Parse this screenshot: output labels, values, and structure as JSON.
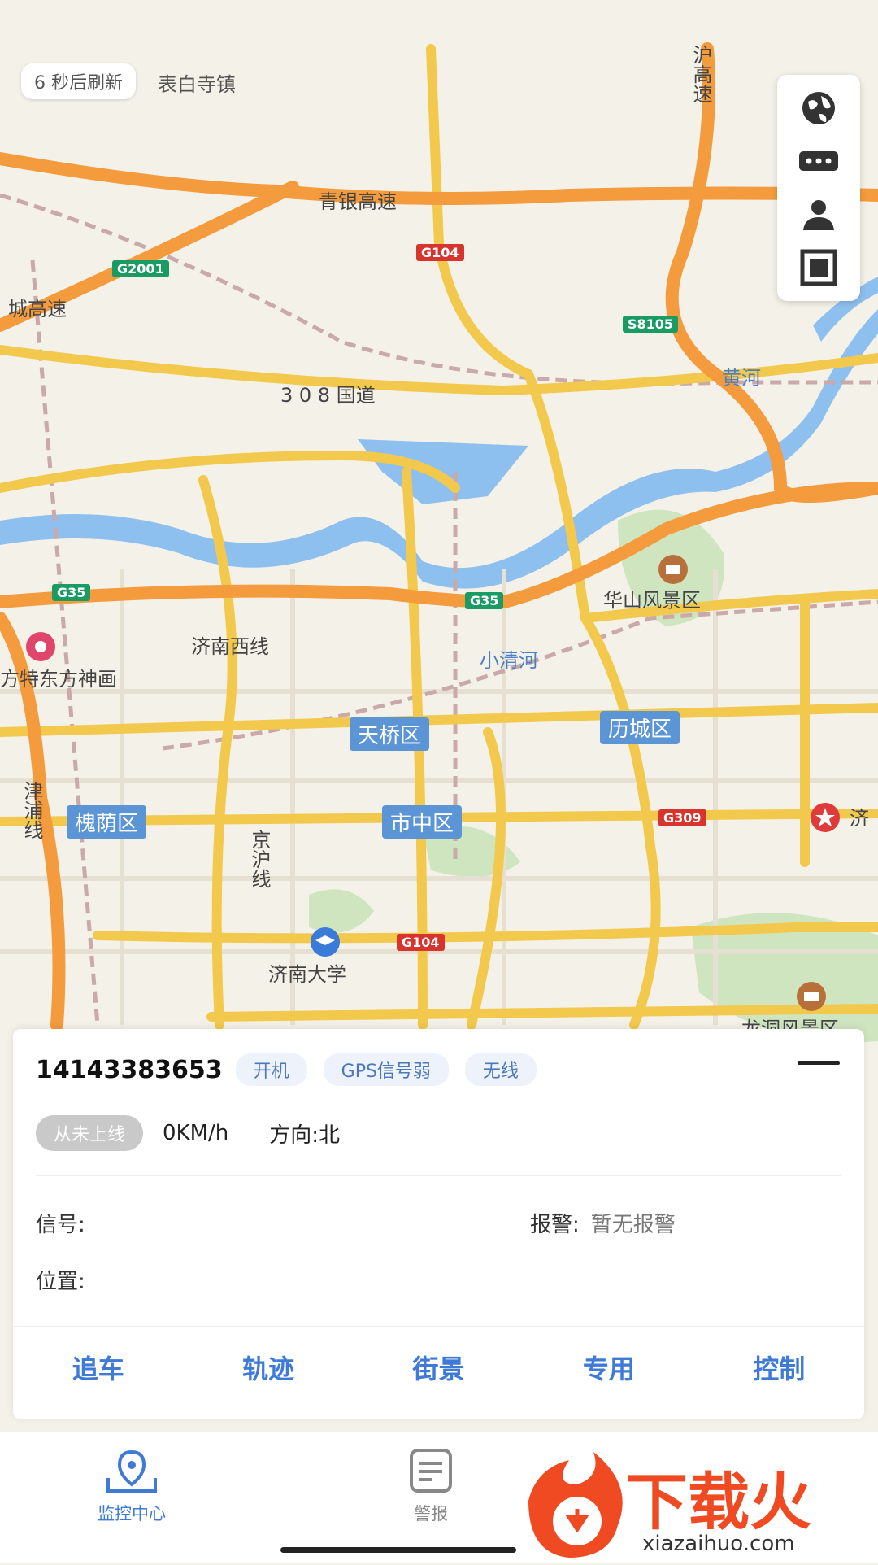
{
  "map": {
    "refresh_text": "6 秒后刷新",
    "town_label": "表白寺镇",
    "labels": {
      "highway_hu": "沪高速",
      "qingyin": "青银高速",
      "guodao_308": "3 0 8 国道",
      "yellow_river": "黄河",
      "huashan": "华山风景区",
      "jinan_west": "济南西线",
      "xiaoqinghe": "小清河",
      "fangte": "方特东方神画",
      "jinhu_line": "京沪线",
      "jinpu_line": "津浦线",
      "jinan_univ": "济南大学",
      "longdong": "龙洞风景区",
      "ji": "济",
      "lingcheng": "城高速"
    },
    "districts": {
      "tianqiao": "天桥区",
      "licheng": "历城区",
      "huaiyin": "槐荫区",
      "shizhong": "市中区"
    },
    "shields": {
      "g2001": "G2001",
      "g104a": "G104",
      "s8105": "S8105",
      "g35a": "G35",
      "g35b": "G35",
      "g309": "G309",
      "g104b": "G104"
    }
  },
  "info": {
    "device_id": "14143383653",
    "tags": [
      "开机",
      "GPS信号弱",
      "无线"
    ],
    "online_status": "从未上线",
    "speed": "0KM/h",
    "direction": "方向:北",
    "signal_label": "信号:",
    "alarm_label": "报警:",
    "alarm_value": "暂无报警",
    "position_label": "位置:",
    "actions": [
      "追车",
      "轨迹",
      "街景",
      "专用",
      "控制"
    ]
  },
  "tabbar": {
    "items": [
      {
        "label": "监控中心"
      },
      {
        "label": "警报"
      }
    ]
  },
  "watermark": {
    "brand": "下载火",
    "url": "xiazaihuo.com"
  },
  "colors": {
    "accent": "#3e7ad6",
    "highway": "#f39b3d",
    "road": "#f2c94c",
    "water": "#8dc0ee"
  }
}
